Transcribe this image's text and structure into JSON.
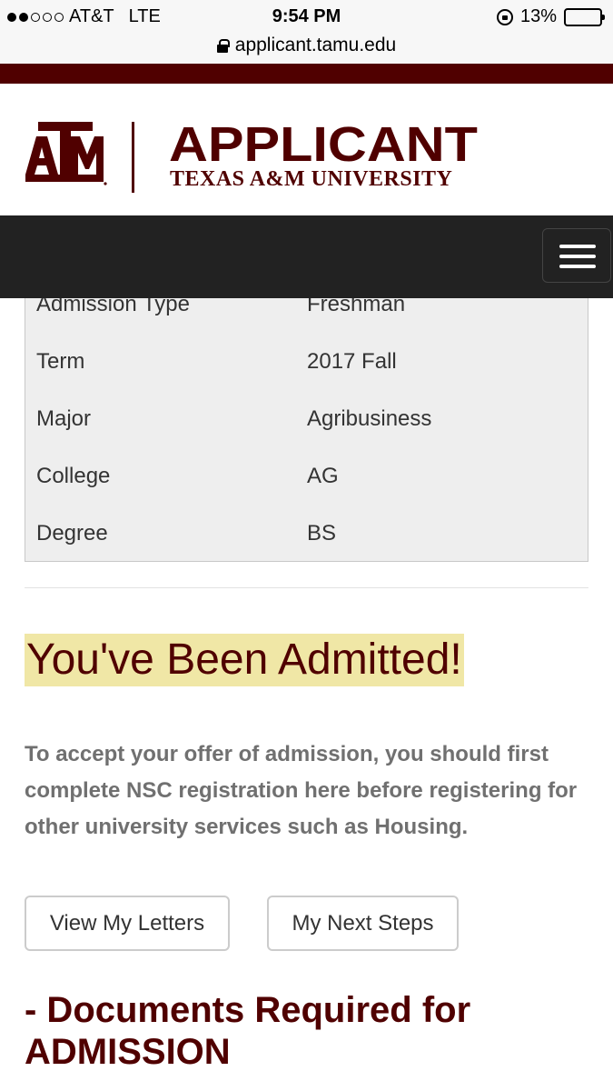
{
  "status_bar": {
    "carrier": "AT&T",
    "network": "LTE",
    "time": "9:54 PM",
    "battery": "13%",
    "battery_level": 0.13,
    "signal_bars": 2
  },
  "browser": {
    "url": "applicant.tamu.edu"
  },
  "brand": {
    "logo_text": "ATM",
    "title": "APPLICANT",
    "subtitle": "TEXAS A&M UNIVERSITY",
    "color": "#500000"
  },
  "info": {
    "rows": [
      {
        "label": "Admission Type",
        "value": "Freshman"
      },
      {
        "label": "Term",
        "value": "2017 Fall"
      },
      {
        "label": "Major",
        "value": "Agribusiness"
      },
      {
        "label": "College",
        "value": "AG"
      },
      {
        "label": "Degree",
        "value": "BS"
      }
    ]
  },
  "main": {
    "admitted_heading": "You've Been Admitted!",
    "accept_text": "To accept your offer of admission, you should first complete NSC registration here before registering for other university services such as Housing.",
    "buttons": {
      "letters": "View My Letters",
      "steps": "My Next Steps"
    },
    "documents_heading": "- Documents Required for ADMISSION"
  }
}
